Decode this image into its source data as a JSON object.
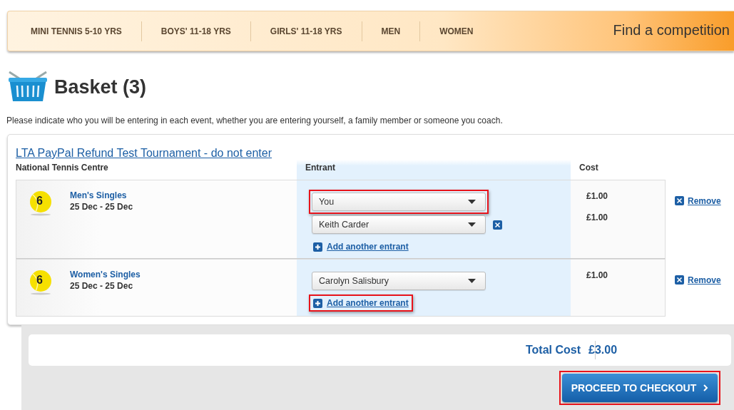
{
  "nav": {
    "items": [
      {
        "label": "MINI TENNIS 5-10 YRS"
      },
      {
        "label": "BOYS' 11-18 YRS"
      },
      {
        "label": "GIRLS' 11-18 YRS"
      },
      {
        "label": "MEN"
      },
      {
        "label": "WOMEN"
      }
    ],
    "search_label": "Find a competition"
  },
  "title": "Basket (3)",
  "instructions": "Please indicate who you will be entering in each event, whether you are entering yourself, a family member or someone you coach.",
  "tournament": {
    "name": "LTA PayPal Refund Test Tournament - do not enter",
    "venue": "National Tennis Centre"
  },
  "columns": {
    "entrant": "Entrant",
    "cost": "Cost"
  },
  "events": [
    {
      "badge": "6",
      "name": "Men's Singles",
      "dates": "25 Dec - 25 Dec",
      "entrants": [
        {
          "value": "You",
          "cost": "£1.00",
          "highlighted": true,
          "removable": false
        },
        {
          "value": "Keith Carder",
          "cost": "£1.00",
          "highlighted": false,
          "removable": true
        }
      ],
      "add_link": {
        "label": "Add another entrant",
        "highlighted": false
      },
      "remove_label": "Remove"
    },
    {
      "badge": "6",
      "name": "Women's Singles",
      "dates": "25 Dec - 25 Dec",
      "entrants": [
        {
          "value": "Carolyn Salisbury",
          "cost": "£1.00",
          "highlighted": false,
          "removable": false
        }
      ],
      "add_link": {
        "label": "Add another entrant",
        "highlighted": true
      },
      "remove_label": "Remove"
    }
  ],
  "total": {
    "label": "Total Cost",
    "value": "£3.00"
  },
  "checkout": {
    "label": "PROCEED TO CHECKOUT",
    "highlighted": true
  }
}
